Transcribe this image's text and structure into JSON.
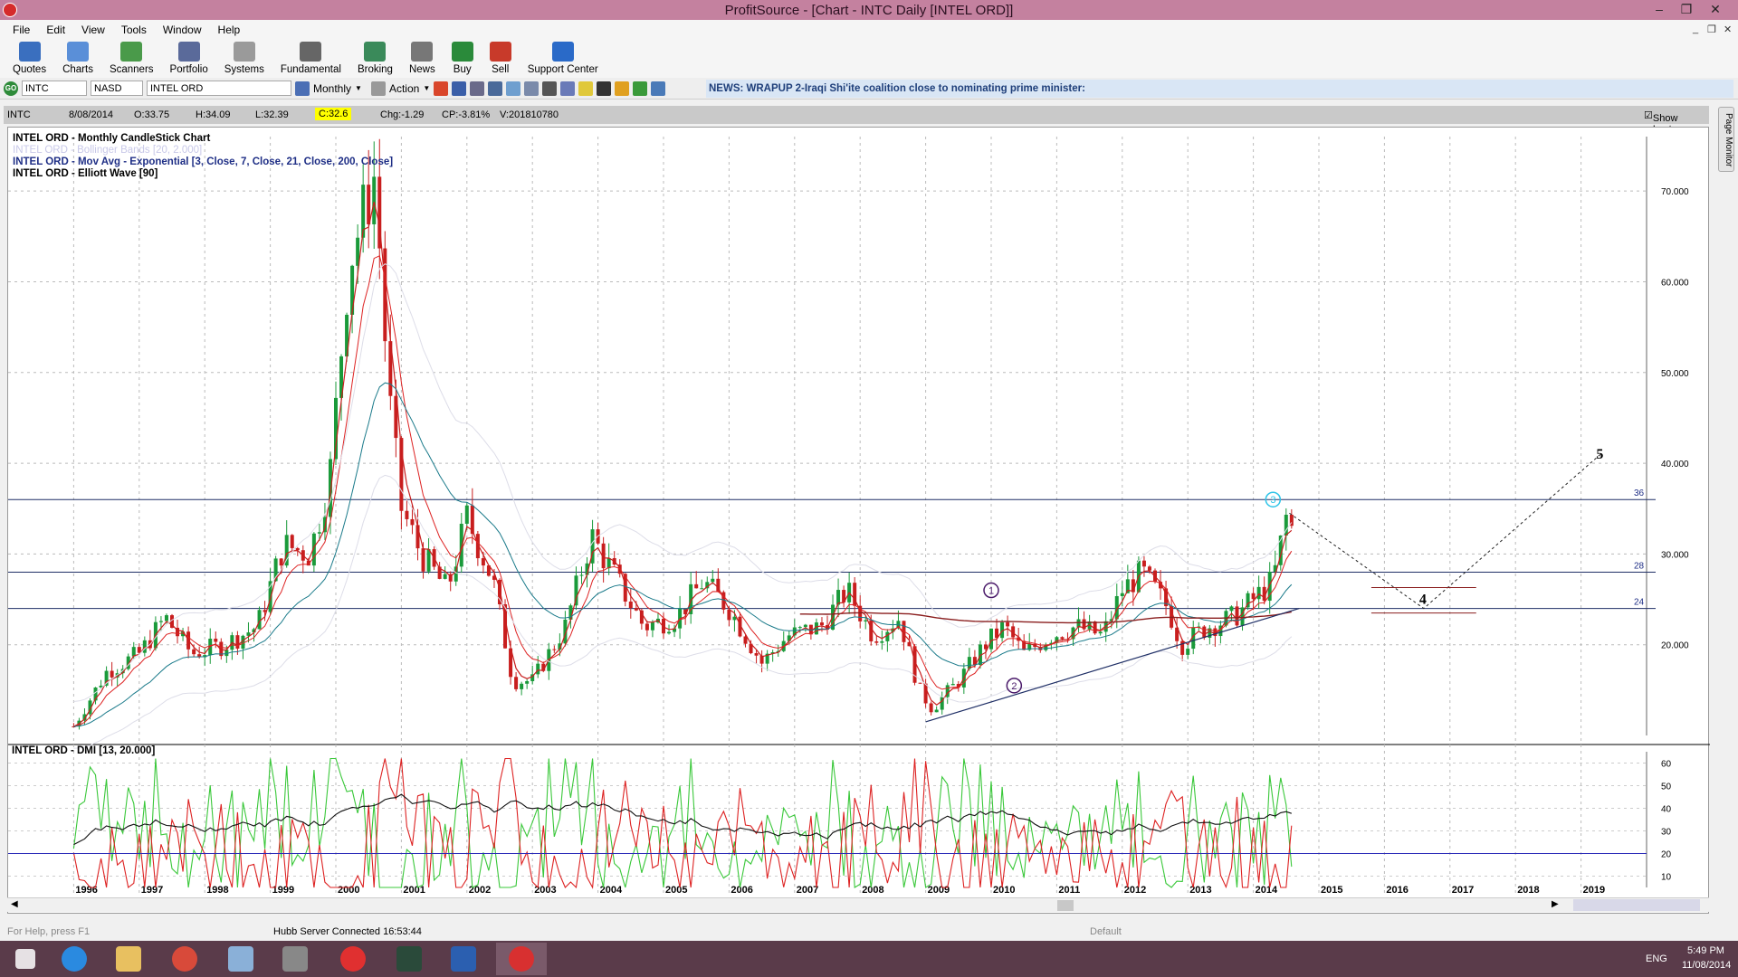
{
  "window": {
    "title": "ProfitSource - [Chart - INTC Daily [INTEL ORD]]"
  },
  "menu": [
    "File",
    "Edit",
    "View",
    "Tools",
    "Window",
    "Help"
  ],
  "toolbar": [
    {
      "label": "Quotes",
      "icon": "quotes-icon",
      "color": "#3a6fbf"
    },
    {
      "label": "Charts",
      "icon": "charts-icon",
      "color": "#5a8fd8"
    },
    {
      "label": "Scanners",
      "icon": "scanners-icon",
      "color": "#4a9a4a"
    },
    {
      "label": "Portfolio",
      "icon": "portfolio-icon",
      "color": "#5a6a9a"
    },
    {
      "label": "Systems",
      "icon": "systems-icon",
      "color": "#9a9a9a"
    },
    {
      "label": "Fundamental",
      "icon": "fundamental-icon",
      "color": "#666666"
    },
    {
      "label": "Broking",
      "icon": "broking-icon",
      "color": "#3a8a5a"
    },
    {
      "label": "News",
      "icon": "news-icon",
      "color": "#777777"
    },
    {
      "label": "Buy",
      "icon": "buy-icon",
      "color": "#2a8a3a"
    },
    {
      "label": "Sell",
      "icon": "sell-icon",
      "color": "#c83a2a"
    },
    {
      "label": "Support Center",
      "icon": "help-icon",
      "color": "#2a6ac8"
    }
  ],
  "security_bar": {
    "symbol": "INTC",
    "exchange": "NASD",
    "name": "INTEL ORD",
    "period": "Monthly",
    "action": "Action"
  },
  "news": "NEWS: WRAPUP 2-Iraqi Shi'ite coalition close to nominating prime minister:",
  "quote": {
    "symbol": "INTC",
    "date": "8/08/2014",
    "open": "O:33.75",
    "high": "H:34.09",
    "low": "L:32.39",
    "close": "C:32.6",
    "change": "Chg:-1.29",
    "change_pct": "CP:-3.81%",
    "volume": "V:201810780"
  },
  "show_last": "Show Last",
  "legend": [
    "INTEL ORD - Monthly CandleStick Chart",
    "INTEL ORD - Bollinger Bands [20, 2.000]",
    "INTEL ORD - Mov Avg - Exponential [3, Close, 7, Close, 21, Close, 200, Close]",
    "INTEL ORD - Elliott Wave [90]"
  ],
  "dmi_title": "INTEL ORD - DMI [13, 20.000]",
  "page_monitor": "Page Monitor",
  "chart_data": {
    "type": "candlestick",
    "price_axis": {
      "ticks": [
        20,
        30,
        40,
        50,
        60,
        70
      ],
      "labels": [
        "20.000",
        "30.000",
        "40.000",
        "50.000",
        "60.000",
        "70.000"
      ],
      "range": [
        10,
        76
      ]
    },
    "years": [
      "1996",
      "1997",
      "1998",
      "1999",
      "2000",
      "2001",
      "2002",
      "2003",
      "2004",
      "2005",
      "2006",
      "2007",
      "2008",
      "2009",
      "2010",
      "2011",
      "2012",
      "2013",
      "2014",
      "2015",
      "2016",
      "2017",
      "2018",
      "2019"
    ],
    "horizontal_lines": [
      {
        "value": 36,
        "label": "36"
      },
      {
        "value": 28,
        "label": "28"
      },
      {
        "value": 24,
        "label": "24"
      }
    ],
    "close_series": [
      {
        "t": 1996.0,
        "v": 11
      },
      {
        "t": 1996.5,
        "v": 17
      },
      {
        "t": 1997.0,
        "v": 19
      },
      {
        "t": 1997.4,
        "v": 23
      },
      {
        "t": 1997.8,
        "v": 19
      },
      {
        "t": 1998.3,
        "v": 20
      },
      {
        "t": 1998.8,
        "v": 22
      },
      {
        "t": 1999.2,
        "v": 31
      },
      {
        "t": 1999.6,
        "v": 30
      },
      {
        "t": 1999.9,
        "v": 38
      },
      {
        "t": 2000.2,
        "v": 62
      },
      {
        "t": 2000.4,
        "v": 67
      },
      {
        "t": 2000.6,
        "v": 72
      },
      {
        "t": 2000.8,
        "v": 48
      },
      {
        "t": 2001.0,
        "v": 35
      },
      {
        "t": 2001.3,
        "v": 30
      },
      {
        "t": 2001.7,
        "v": 26
      },
      {
        "t": 2002.0,
        "v": 34
      },
      {
        "t": 2002.4,
        "v": 27
      },
      {
        "t": 2002.7,
        "v": 16
      },
      {
        "t": 2003.0,
        "v": 16
      },
      {
        "t": 2003.5,
        "v": 22
      },
      {
        "t": 2003.9,
        "v": 32
      },
      {
        "t": 2004.3,
        "v": 27
      },
      {
        "t": 2004.7,
        "v": 22
      },
      {
        "t": 2005.2,
        "v": 23
      },
      {
        "t": 2005.6,
        "v": 27
      },
      {
        "t": 2006.0,
        "v": 24
      },
      {
        "t": 2006.5,
        "v": 18
      },
      {
        "t": 2006.9,
        "v": 21
      },
      {
        "t": 2007.4,
        "v": 22
      },
      {
        "t": 2007.8,
        "v": 26
      },
      {
        "t": 2008.2,
        "v": 21
      },
      {
        "t": 2008.6,
        "v": 23
      },
      {
        "t": 2008.9,
        "v": 15
      },
      {
        "t": 2009.1,
        "v": 13
      },
      {
        "t": 2009.5,
        "v": 16
      },
      {
        "t": 2009.9,
        "v": 20
      },
      {
        "t": 2010.2,
        "v": 22
      },
      {
        "t": 2010.5,
        "v": 19
      },
      {
        "t": 2010.9,
        "v": 21
      },
      {
        "t": 2011.3,
        "v": 22
      },
      {
        "t": 2011.7,
        "v": 21
      },
      {
        "t": 2012.0,
        "v": 26
      },
      {
        "t": 2012.3,
        "v": 28
      },
      {
        "t": 2012.7,
        "v": 24
      },
      {
        "t": 2012.9,
        "v": 20
      },
      {
        "t": 2013.3,
        "v": 22
      },
      {
        "t": 2013.7,
        "v": 23
      },
      {
        "t": 2014.0,
        "v": 25
      },
      {
        "t": 2014.3,
        "v": 27
      },
      {
        "t": 2014.5,
        "v": 34
      },
      {
        "t": 2014.6,
        "v": 32.6
      }
    ],
    "elliott_labels": [
      {
        "t": 2010.0,
        "v": 26,
        "label": "1"
      },
      {
        "t": 2010.35,
        "v": 15.5,
        "label": "2"
      },
      {
        "t": 2014.3,
        "v": 36,
        "label": "3"
      },
      {
        "t": 2016.6,
        "v": 25,
        "label": "4"
      },
      {
        "t": 2019.3,
        "v": 41,
        "label": "5"
      }
    ],
    "dmi_axis": {
      "ticks": [
        10,
        20,
        30,
        40,
        50,
        60
      ],
      "range": [
        5,
        65
      ]
    }
  },
  "status": {
    "left": "For Help, press F1",
    "server": "Hubb Server Connected 16:53:44",
    "mode": "Default"
  },
  "tray": {
    "lang": "ENG",
    "time": "5:49 PM",
    "date": "11/08/2014"
  }
}
